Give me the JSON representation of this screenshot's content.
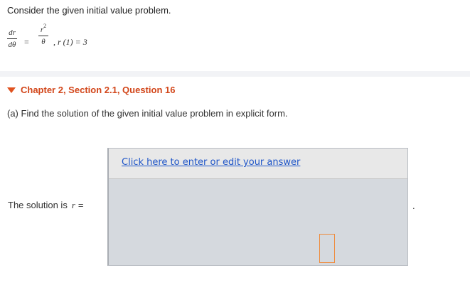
{
  "intro": "Consider the given initial value problem.",
  "equation": {
    "lhs_num": "dr",
    "lhs_den": "dθ",
    "eq": "=",
    "rhs_num_base": "r",
    "rhs_num_exp": "2",
    "rhs_den": "θ",
    "condition": ", r (1) = 3"
  },
  "chapter": {
    "label": "Chapter 2, Section 2.1, Question 16",
    "accent_color": "#d2461a",
    "icon": "triangle-down-icon"
  },
  "question": "(a) Find the solution of the given initial value problem in explicit form.",
  "solution": {
    "label": "The solution is",
    "variable": "r",
    "equals": "="
  },
  "answer": {
    "link_text": "Click here to enter or edit your answer",
    "link_color": "#1e55c8",
    "placeholder_color": "#ef8a3a"
  },
  "trailing": "."
}
